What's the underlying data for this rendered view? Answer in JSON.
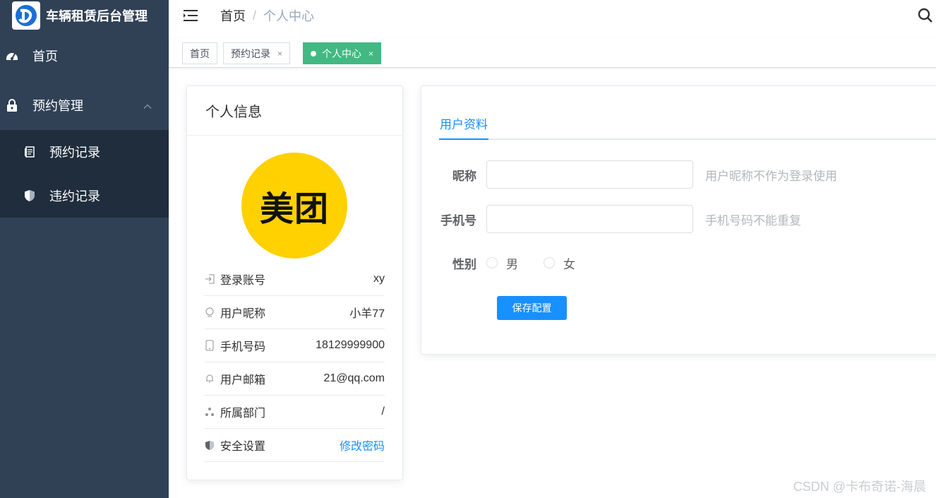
{
  "app": {
    "title": "车辆租赁后台管理",
    "logo_icon": "logo-icon"
  },
  "sidebar": {
    "items": [
      {
        "label": "首页",
        "icon": "dashboard-icon"
      },
      {
        "label": "预约管理",
        "icon": "lock-icon",
        "expanded": true,
        "children": [
          {
            "label": "预约记录",
            "icon": "document-icon"
          },
          {
            "label": "违约记录",
            "icon": "shield-icon"
          }
        ]
      }
    ]
  },
  "navbar": {
    "breadcrumb": [
      "首页",
      "个人中心"
    ],
    "separator": "/"
  },
  "tags": [
    {
      "label": "首页",
      "closable": false,
      "active": false
    },
    {
      "label": "预约记录",
      "closable": true,
      "active": false
    },
    {
      "label": "个人中心",
      "closable": true,
      "active": true
    }
  ],
  "tag_close": "×",
  "profile": {
    "header": "个人信息",
    "avatar_text": "美团",
    "rows": [
      {
        "label": "登录账号",
        "value": "xy",
        "icon": "login-icon"
      },
      {
        "label": "用户昵称",
        "value": "小羊77",
        "icon": "user-icon"
      },
      {
        "label": "手机号码",
        "value": "18129999900",
        "icon": "phone-icon"
      },
      {
        "label": "用户邮箱",
        "value": "21@qq.com",
        "icon": "email-icon"
      },
      {
        "label": "所属部门",
        "value": "/",
        "icon": "tree-icon"
      },
      {
        "label": "安全设置",
        "value": "修改密码",
        "icon": "security-icon"
      }
    ]
  },
  "form": {
    "tab": "用户资料",
    "nickname": {
      "label": "昵称",
      "value": "",
      "hint": "用户昵称不作为登录使用"
    },
    "phone": {
      "label": "手机号",
      "value": "",
      "hint": "手机号码不能重复"
    },
    "gender": {
      "label": "性别",
      "options": [
        "男",
        "女"
      ]
    },
    "save_label": "保存配置"
  },
  "watermark": "CSDN @卡布奇诺-海晨",
  "colors": {
    "sidebar_bg": "#304156",
    "submenu_bg": "#1f2d3d",
    "accent": "#1890ff",
    "active_tag": "#42b983",
    "avatar_bg": "#ffd100"
  }
}
